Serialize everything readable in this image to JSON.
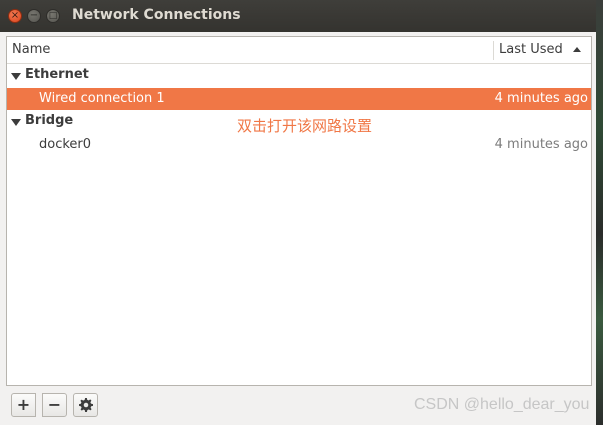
{
  "window": {
    "title": "Network Connections",
    "controls": {
      "close_icon": "×",
      "minimize_icon": "−",
      "maximize_icon": "□"
    }
  },
  "list": {
    "columns": {
      "name": "Name",
      "last_used": "Last Used"
    },
    "groups": [
      {
        "label": "Ethernet",
        "items": [
          {
            "name": "Wired connection 1",
            "last_used": "4 minutes ago",
            "selected": true
          }
        ]
      },
      {
        "label": "Bridge",
        "items": [
          {
            "name": "docker0",
            "last_used": "4 minutes ago",
            "selected": false
          }
        ]
      }
    ]
  },
  "annotation": "双击打开该网路设置",
  "toolbar": {
    "add_label": "+",
    "remove_label": "−"
  },
  "watermark": "CSDN @hello_dear_you",
  "colors": {
    "selection": "#f07746",
    "titlebar": "#3c3b37",
    "annotation": "#f07746"
  }
}
